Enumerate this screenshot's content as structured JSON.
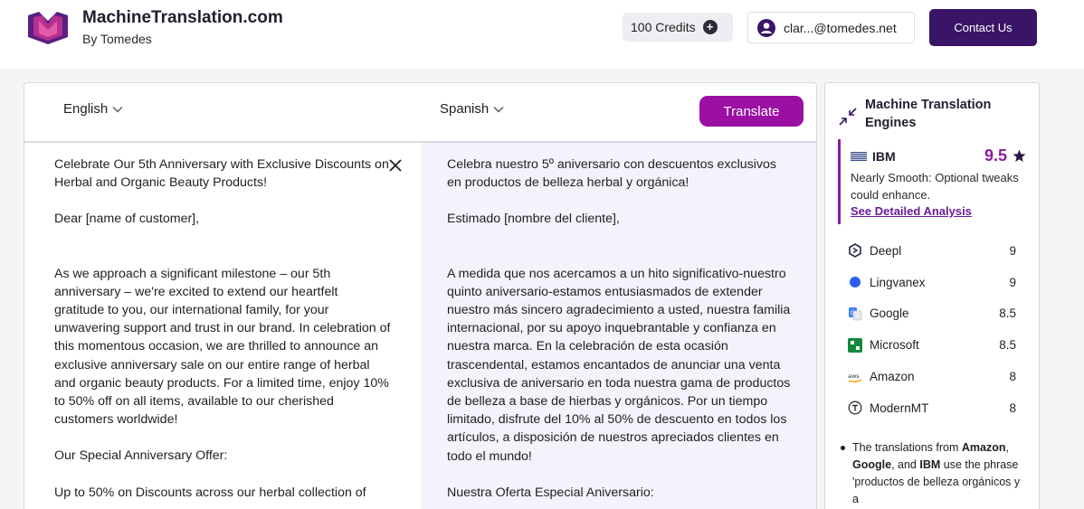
{
  "header": {
    "brand_title": "MachineTranslation.com",
    "brand_sub": "By Tomedes",
    "credits_label": "100 Credits",
    "user_email": "clar...@tomedes.net",
    "contact_label": "Contact Us",
    "brand_color": "#3a1567"
  },
  "translator": {
    "source_language": "English",
    "target_language": "Spanish",
    "translate_label": "Translate",
    "accent_color": "#9b0fa3",
    "source_paragraphs": [
      "Celebrate Our 5th Anniversary with Exclusive Discounts on Herbal and Organic Beauty Products!",
      "Dear [name of customer],",
      "",
      "As we approach a significant milestone – our 5th anniversary – we're excited to extend our heartfelt gratitude to you, our international family, for your unwavering support and trust in our brand. In celebration of this momentous occasion, we are thrilled to announce an exclusive anniversary sale on our entire range of herbal and organic beauty products. For a limited time, enjoy 10% to 50% off on all items, available to our cherished customers worldwide!",
      "Our Special Anniversary Offer:",
      "Up to 50% on Discounts across our herbal collection of"
    ],
    "target_paragraphs": [
      "Celebra nuestro 5º aniversario con descuentos exclusivos en productos de belleza herbal y orgánica!",
      "Estimado [nombre del cliente],",
      "",
      "A medida que nos acercamos a un hito significativo-nuestro quinto aniversario-estamos entusiasmados de extender nuestro más sincero agradecimiento a usted, nuestra familia internacional, por su apoyo inquebrantable y confianza en nuestra marca. En la celebración de esta ocasión trascendental, estamos encantados de anunciar una venta exclusiva de aniversario en toda nuestra gama de productos de belleza a base de hierbas y orgánicos. Por un tiempo limitado, disfrute del 10% al 50% de descuento en todos los artículos, a disposición de nuestros apreciados clientes en todo el mundo!",
      "Nuestra Oferta Especial Aniversario:"
    ]
  },
  "engines": {
    "title": "Machine Translation Engines",
    "top": {
      "name": "IBM",
      "score": "9.5",
      "description": "Nearly Smooth: Optional tweaks could enhance.",
      "link_label": "See Detailed Analysis",
      "icon": "ibm-icon"
    },
    "list": [
      {
        "name": "Deepl",
        "score": "9",
        "icon": "deepl-icon"
      },
      {
        "name": "Lingvanex",
        "score": "9",
        "icon": "lingvanex-icon"
      },
      {
        "name": "Google",
        "score": "8.5",
        "icon": "google-icon"
      },
      {
        "name": "Microsoft",
        "score": "8.5",
        "icon": "microsoft-icon"
      },
      {
        "name": "Amazon",
        "score": "8",
        "icon": "amazon-icon"
      },
      {
        "name": "ModernMT",
        "score": "8",
        "icon": "modernmt-icon"
      }
    ],
    "note": {
      "prefix": "The translations from ",
      "engine_a": "Amazon",
      "sep1": ", ",
      "engine_b": "Google",
      "sep2": ", and ",
      "engine_c": "IBM",
      "suffix": " use the phrase 'productos de belleza orgánicos y a"
    }
  }
}
